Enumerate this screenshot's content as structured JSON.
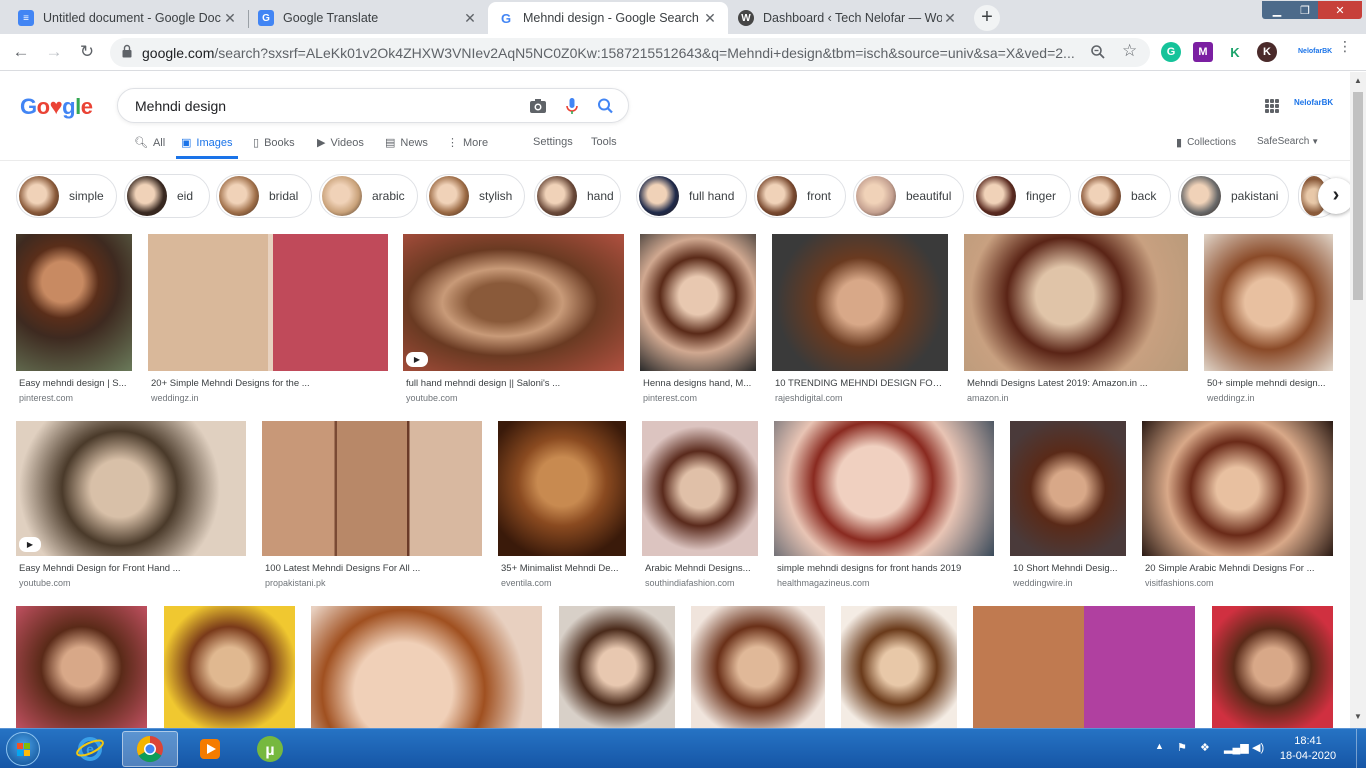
{
  "browser": {
    "tabs": [
      {
        "title": "Untitled document - Google Doc",
        "icon": "google-docs-icon",
        "color": "#4285f4",
        "active": false
      },
      {
        "title": "Google Translate",
        "icon": "google-translate-icon",
        "color": "#4285f4",
        "active": false
      },
      {
        "title": "Mehndi design - Google Search",
        "icon": "google-icon",
        "color": "#ea4335",
        "active": true
      },
      {
        "title": "Dashboard ‹ Tech Nelofar — Wo",
        "icon": "wordpress-icon",
        "color": "#464646",
        "active": false
      }
    ],
    "new_tab": "+",
    "url_host": "google.com",
    "url_rest": "/search?sxsrf=ALeKk01v2Ok4ZHXW3VNIev2AqN5NC0Z0Kw:1587215512643&q=Mehndi+design&tbm=isch&source=univ&sa=X&ved=2...",
    "extensions": [
      {
        "name": "grammarly-icon",
        "letter": "G",
        "color": "#15c39a"
      },
      {
        "name": "extension-m-icon",
        "letter": "M",
        "color": "#7b1fa2"
      },
      {
        "name": "keepa-icon",
        "letter": "K",
        "color": "#1ca36b"
      },
      {
        "name": "profile-k-icon",
        "letter": "K",
        "color": "#4a2a2a"
      }
    ],
    "profile_tag": "NelofarBK"
  },
  "google": {
    "logo": "Google",
    "query": "Mehndi design",
    "nav": [
      {
        "label": "All",
        "icon": "search-icon"
      },
      {
        "label": "Images",
        "icon": "image-icon"
      },
      {
        "label": "Books",
        "icon": "book-icon"
      },
      {
        "label": "Videos",
        "icon": "video-icon"
      },
      {
        "label": "News",
        "icon": "news-icon"
      },
      {
        "label": "More",
        "icon": "more-icon"
      }
    ],
    "settings": "Settings",
    "tools": "Tools",
    "collections": "Collections",
    "safesearch": "SafeSearch",
    "account_tag": "NelofarBK"
  },
  "chips": [
    "simple",
    "eid",
    "bridal",
    "arabic",
    "stylish",
    "hand",
    "full hand",
    "front",
    "beautiful",
    "finger",
    "back",
    "pakistani"
  ],
  "results_row1": [
    {
      "caption": "Easy mehndi design | S...",
      "source": "pinterest.com",
      "video": false
    },
    {
      "caption": "20+ Simple Mehndi Designs for the ...",
      "source": "weddingz.in",
      "video": false
    },
    {
      "caption": "full hand mehndi design || Saloni's ...",
      "source": "youtube.com",
      "video": true
    },
    {
      "caption": "Henna designs hand, M...",
      "source": "pinterest.com",
      "video": false
    },
    {
      "caption": "10 TRENDING MEHNDI DESIGN FOR ...",
      "source": "rajeshdigital.com",
      "video": false
    },
    {
      "caption": "Mehndi Designs Latest 2019: Amazon.in ...",
      "source": "amazon.in",
      "video": false
    },
    {
      "caption": "50+ simple mehndi design...",
      "source": "weddingz.in",
      "video": false
    }
  ],
  "results_row2": [
    {
      "caption": "Easy Mehndi Design for Front Hand ...",
      "source": "youtube.com",
      "video": true
    },
    {
      "caption": "100 Latest Mehndi Designs For All ...",
      "source": "propakistani.pk",
      "video": false
    },
    {
      "caption": "35+ Minimalist Mehndi De...",
      "source": "eventila.com",
      "video": false
    },
    {
      "caption": "Arabic Mehndi Designs...",
      "source": "southindiafashion.com",
      "video": false
    },
    {
      "caption": "simple mehndi designs for front hands 2019",
      "source": "healthmagazineus.com",
      "video": false
    },
    {
      "caption": "10 Short Mehndi Desig...",
      "source": "weddingwire.in",
      "video": false
    },
    {
      "caption": "20 Simple Arabic Mehndi Designs For ...",
      "source": "visitfashions.com",
      "video": false
    }
  ],
  "taskbar": {
    "apps": [
      "internet-explorer-icon",
      "chrome-icon",
      "media-player-icon",
      "utorrent-icon"
    ],
    "time": "18:41",
    "date": "18-04-2020"
  }
}
